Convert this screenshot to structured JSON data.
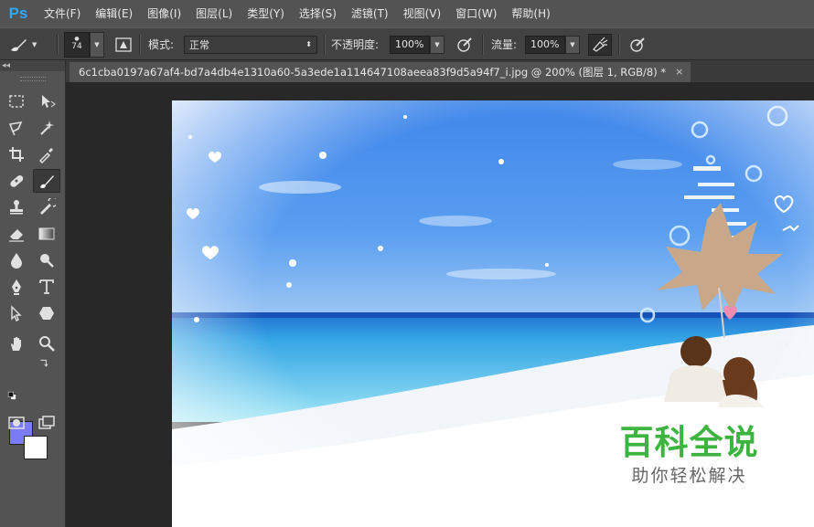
{
  "app": {
    "logo": "Ps"
  },
  "menu": [
    "文件(F)",
    "编辑(E)",
    "图像(I)",
    "图层(L)",
    "类型(Y)",
    "选择(S)",
    "滤镜(T)",
    "视图(V)",
    "窗口(W)",
    "帮助(H)"
  ],
  "options": {
    "brush_size": "74",
    "mode_label": "模式:",
    "mode_value": "正常",
    "opacity_label": "不透明度:",
    "opacity_value": "100%",
    "flow_label": "流量:",
    "flow_value": "100%"
  },
  "document": {
    "tab_title": "6c1cba0197a67af4-bd7a4db4e1310a60-5a3ede1a114647108aeea83f9d5a94f7_i.jpg @ 200% (图层 1, RGB/8) *",
    "close_glyph": "×"
  },
  "toolbox": {
    "collapse_glyph": "◂◂",
    "foreground_color": "#7b7bf5",
    "background_color": "#ffffff"
  },
  "watermark": {
    "main": "百科全说",
    "sub": "助你轻松解决"
  }
}
